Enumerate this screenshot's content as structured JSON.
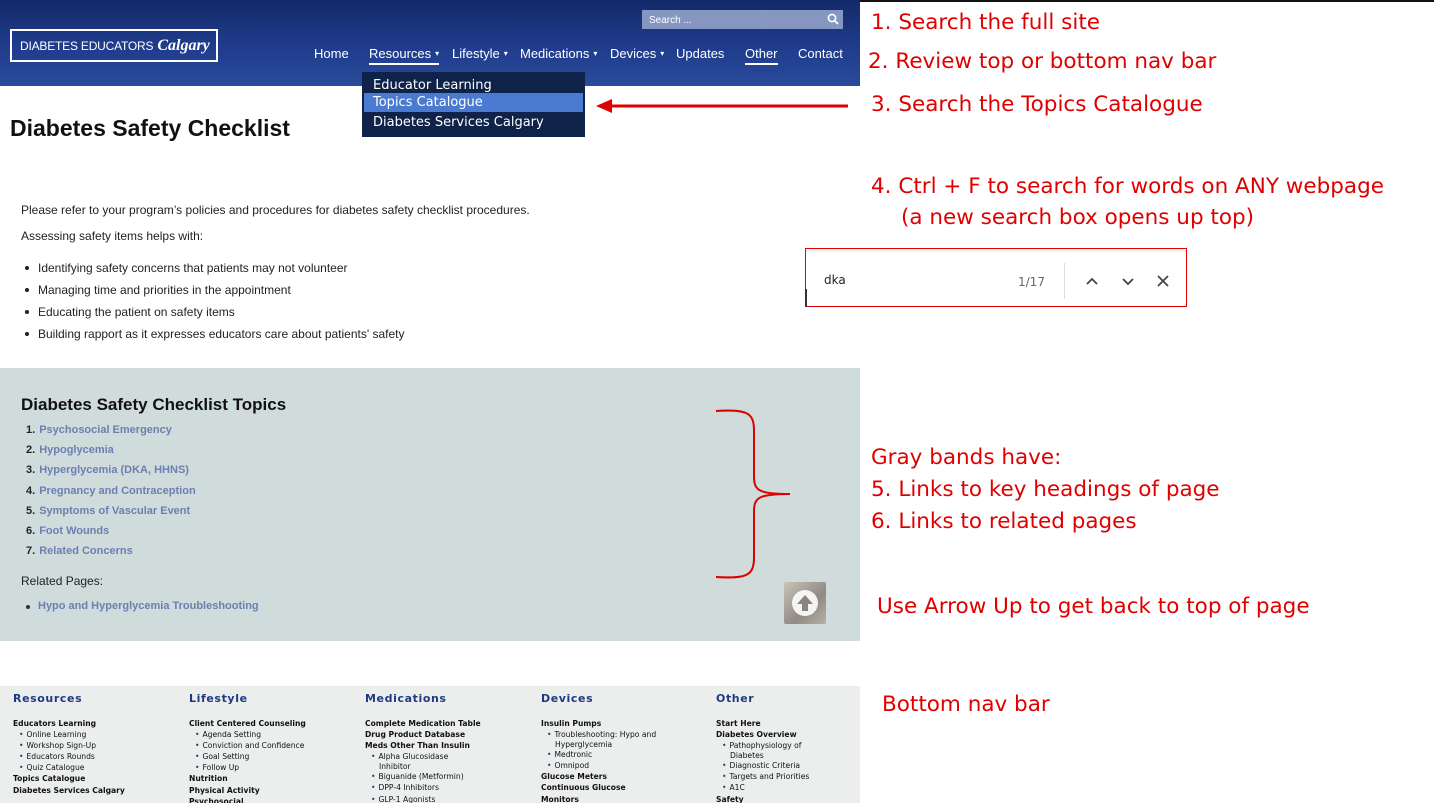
{
  "header": {
    "logo_text": "DIABETES EDUCATORS",
    "logo_script": "Calgary",
    "search_placeholder": "Search ...",
    "nav": [
      {
        "label": "Home",
        "caret": false,
        "active": false
      },
      {
        "label": "Resources",
        "caret": true,
        "active": true
      },
      {
        "label": "Lifestyle",
        "caret": true,
        "active": false
      },
      {
        "label": "Medications",
        "caret": true,
        "active": false
      },
      {
        "label": "Devices",
        "caret": true,
        "active": false
      },
      {
        "label": "Updates",
        "caret": false,
        "active": false
      },
      {
        "label": "Other",
        "caret": false,
        "active": true
      },
      {
        "label": "Contact",
        "caret": false,
        "active": false
      }
    ],
    "caret_glyph": "▾",
    "dropdown": [
      "Educator Learning",
      "Topics Catalogue",
      "Diabetes Services Calgary"
    ]
  },
  "page": {
    "title": "Diabetes Safety Checklist",
    "intro1": "Please refer to your program’s policies and procedures for diabetes safety checklist procedures.",
    "intro2": "Assessing safety items helps with:",
    "bullets": [
      "Identifying safety concerns that patients may not volunteer",
      "Managing time and priorities in the appointment",
      "Educating the patient on safety items",
      "Building rapport as it expresses educators care about patients' safety"
    ]
  },
  "band": {
    "heading": "Diabetes Safety Checklist Topics",
    "topics": [
      {
        "num": "1.",
        "label": "Psychosocial Emergency"
      },
      {
        "num": "2.",
        "label": "Hypoglycemia"
      },
      {
        "num": "3.",
        "label": "Hyperglycemia (DKA,  HHNS)"
      },
      {
        "num": "4.",
        "label": "Pregnancy and Contraception"
      },
      {
        "num": "5.",
        "label": "Symptoms of Vascular Event"
      },
      {
        "num": "6.",
        "label": "Foot Wounds"
      },
      {
        "num": "7.",
        "label": "Related Concerns"
      }
    ],
    "related_label": "Related Pages:",
    "related": [
      "Hypo and Hyperglycemia Troubleshooting"
    ]
  },
  "footer": {
    "columns": [
      {
        "heading": "Resources",
        "items": [
          {
            "t": "Educators Learning",
            "k": "b"
          },
          {
            "t": "Online Learning",
            "k": "s"
          },
          {
            "t": "Workshop Sign-Up",
            "k": "s"
          },
          {
            "t": "Educators Rounds",
            "k": "s"
          },
          {
            "t": "Quiz Catalogue",
            "k": "s"
          },
          {
            "t": "Topics Catalogue",
            "k": "b"
          },
          {
            "t": "Diabetes Services Calgary",
            "k": "b"
          }
        ]
      },
      {
        "heading": "Lifestyle",
        "items": [
          {
            "t": "Client Centered Counseling",
            "k": "b"
          },
          {
            "t": "Agenda Setting",
            "k": "s"
          },
          {
            "t": "Conviction and Confidence",
            "k": "s"
          },
          {
            "t": "Goal Setting",
            "k": "s"
          },
          {
            "t": "Follow Up",
            "k": "s"
          },
          {
            "t": "Nutrition",
            "k": "b"
          },
          {
            "t": "Physical Activity",
            "k": "b"
          },
          {
            "t": "Psychosocial",
            "k": "b"
          }
        ]
      },
      {
        "heading": "Medications",
        "items": [
          {
            "t": "Complete Medication Table",
            "k": "b"
          },
          {
            "t": "Drug Product Database",
            "k": "b"
          },
          {
            "t": "Meds Other Than Insulin",
            "k": "b"
          },
          {
            "t": "Alpha Glucosidase",
            "k": "s"
          },
          {
            "t": "Inhibitor",
            "k": "c"
          },
          {
            "t": "Biguanide (Metformin)",
            "k": "s"
          },
          {
            "t": "DPP-4 Inhibitors",
            "k": "s"
          },
          {
            "t": "GLP-1 Agonists",
            "k": "s"
          }
        ]
      },
      {
        "heading": "Devices",
        "items": [
          {
            "t": "Insulin Pumps",
            "k": "b"
          },
          {
            "t": "Troubleshooting: Hypo and",
            "k": "s"
          },
          {
            "t": "Hyperglycemia",
            "k": "c"
          },
          {
            "t": "Medtronic",
            "k": "s"
          },
          {
            "t": "Omnipod",
            "k": "s"
          },
          {
            "t": "Glucose Meters",
            "k": "b"
          },
          {
            "t": "Continuous Glucose",
            "k": "b"
          },
          {
            "t": "Monitors",
            "k": "b"
          }
        ]
      },
      {
        "heading": "Other",
        "items": [
          {
            "t": "Start Here",
            "k": "b"
          },
          {
            "t": "Diabetes Overview",
            "k": "b"
          },
          {
            "t": "Pathophysiology of",
            "k": "s"
          },
          {
            "t": "Diabetes",
            "k": "c"
          },
          {
            "t": "Diagnostic Criteria",
            "k": "s"
          },
          {
            "t": "Targets and Priorities",
            "k": "s"
          },
          {
            "t": "A1C",
            "k": "s"
          },
          {
            "t": "Safety",
            "k": "b"
          }
        ]
      }
    ]
  },
  "find_bar": {
    "query": "dka",
    "count": "1/17"
  },
  "annotations": {
    "a1": "1. Search the full site",
    "a2": "2. Review top or bottom nav bar",
    "a3": "3. Search the Topics Catalogue",
    "a4": "4.  Ctrl + F to search for words on ANY webpage",
    "a4b": "(a new search box opens up top)",
    "a5": "Gray bands have:",
    "a6": "5.  Links to key headings of page",
    "a7": "6.  Links to related pages",
    "a8": "Use Arrow Up to get back to top of page",
    "a9": "Bottom nav bar"
  },
  "colors": {
    "annotation": "#e00000",
    "header_blue": "#203c8c",
    "link": "#6b7fb2",
    "band": "#d0dcdb",
    "dropdown_highlight": "#4a7bd0"
  }
}
